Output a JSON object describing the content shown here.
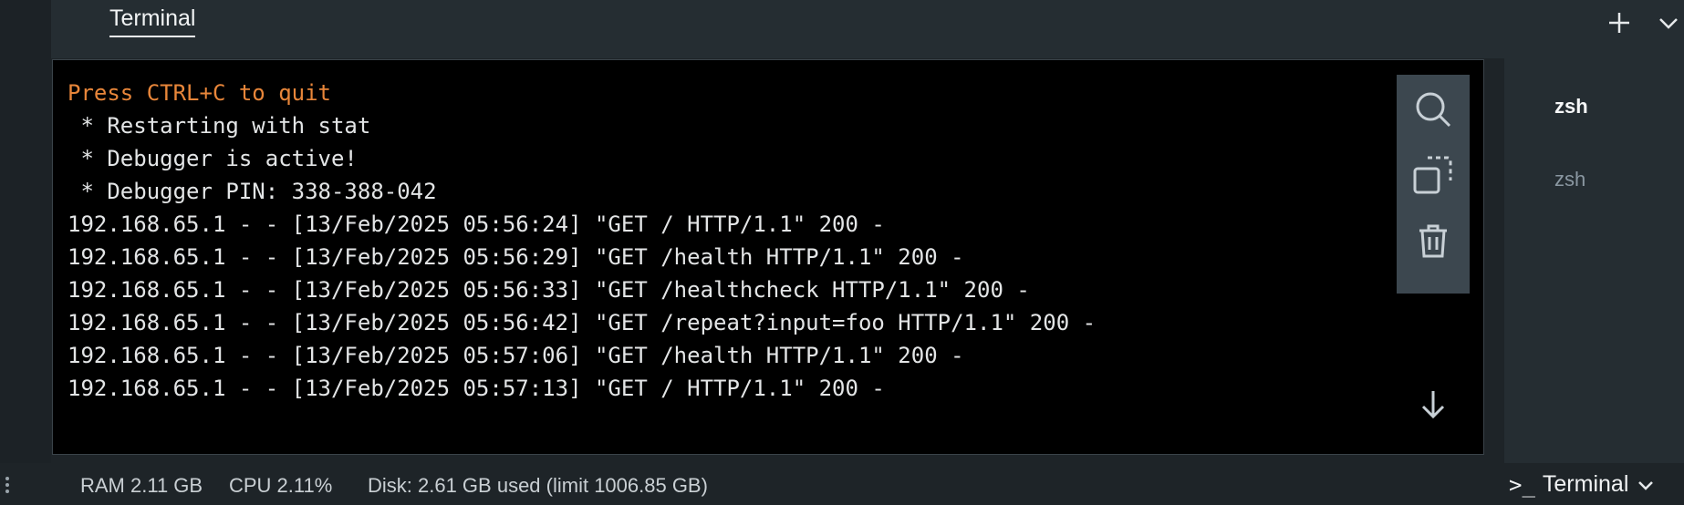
{
  "tabbar": {
    "active_tab": "Terminal",
    "add_icon": "plus-icon",
    "collapse_icon": "chevron-down-icon"
  },
  "terminal": {
    "lines": [
      {
        "text": "Press CTRL+C to quit",
        "style": "warn"
      },
      {
        "text": " * Restarting with stat",
        "style": "normal"
      },
      {
        "text": " * Debugger is active!",
        "style": "normal"
      },
      {
        "text": " * Debugger PIN: 338-388-042",
        "style": "normal"
      },
      {
        "text": "192.168.65.1 - - [13/Feb/2025 05:56:24] \"GET / HTTP/1.1\" 200 -",
        "style": "normal"
      },
      {
        "text": "192.168.65.1 - - [13/Feb/2025 05:56:29] \"GET /health HTTP/1.1\" 200 -",
        "style": "normal"
      },
      {
        "text": "192.168.65.1 - - [13/Feb/2025 05:56:33] \"GET /healthcheck HTTP/1.1\" 200 -",
        "style": "normal"
      },
      {
        "text": "192.168.65.1 - - [13/Feb/2025 05:56:42] \"GET /repeat?input=foo HTTP/1.1\" 200 -",
        "style": "normal"
      },
      {
        "text": "192.168.65.1 - - [13/Feb/2025 05:57:06] \"GET /health HTTP/1.1\" 200 -",
        "style": "normal"
      },
      {
        "text": "192.168.65.1 - - [13/Feb/2025 05:57:13] \"GET / HTTP/1.1\" 200 -",
        "style": "normal"
      }
    ],
    "tools": [
      "search-icon",
      "copy-icon",
      "trash-icon"
    ],
    "scroll_icon": "arrow-down-icon"
  },
  "sessions": {
    "items": [
      {
        "label": "zsh",
        "active": true
      },
      {
        "label": "zsh",
        "active": false
      }
    ]
  },
  "status": {
    "ram": "RAM 2.11 GB",
    "cpu": "CPU 2.11%",
    "disk": "Disk: 2.61 GB used (limit 1006.85 GB)",
    "terminal_prompt": ">_",
    "terminal_label": "Terminal",
    "terminal_chevron": "chevron-down-icon"
  },
  "colors": {
    "warn": "#e8863a",
    "terminal_bg": "#000000",
    "panel_bg": "#252d32"
  }
}
